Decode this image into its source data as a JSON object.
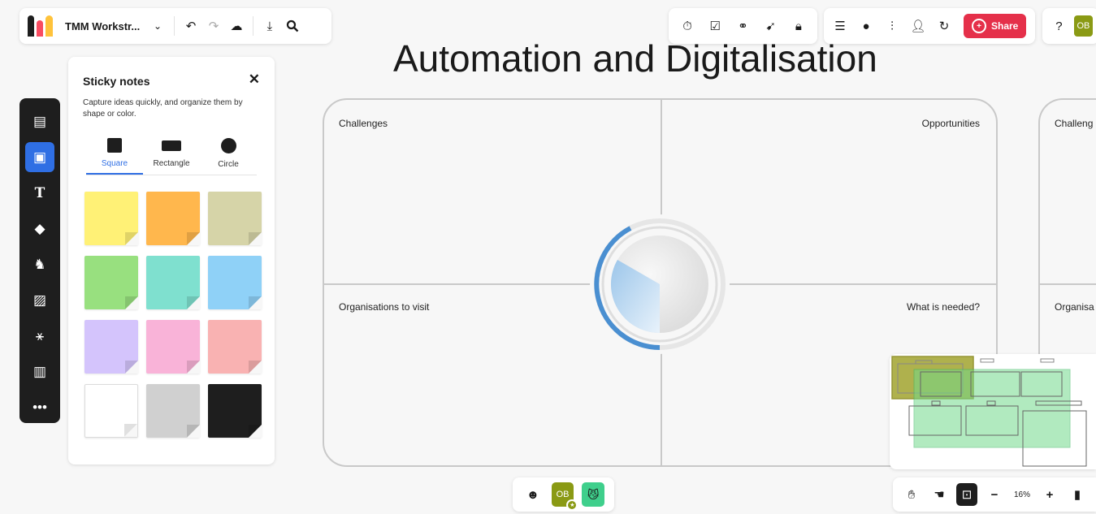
{
  "topbar": {
    "board_name": "TMM Workstr...",
    "colors": {
      "logo": [
        "#f94c61",
        "#ffc33b",
        "#7b5cf5",
        "#1e1e1e"
      ]
    }
  },
  "collab": {
    "share_label": "Share",
    "avatar": "OB"
  },
  "sticky_panel": {
    "title": "Sticky notes",
    "description": "Capture ideas quickly, and organize them by shape or color.",
    "shapes": [
      {
        "label": "Square",
        "icon": "square-shape-icon",
        "active": true
      },
      {
        "label": "Rectangle",
        "icon": "rectangle-shape-icon",
        "active": false
      },
      {
        "label": "Circle",
        "icon": "circle-shape-icon",
        "active": false
      }
    ],
    "colors": [
      "#fff176",
      "#ffb74d",
      "#d6d4a8",
      "#98e07f",
      "#7fe0cf",
      "#8fd1f7",
      "#d4c4fc",
      "#f9b3d8",
      "#f9b2b2",
      "#ffffff",
      "#d0d0d0",
      "#1e1e1e"
    ]
  },
  "board": {
    "title": "Automation and Digitalisation",
    "quadrants": {
      "top_left": "Challenges",
      "top_right": "Opportunities",
      "bottom_left": "Organisations to visit",
      "bottom_right": "What is needed?"
    },
    "second_frame": {
      "top": "Challeng",
      "bottom": "Organisa"
    }
  },
  "bottom_center": {
    "avatar": "OB"
  },
  "bottom_right": {
    "zoom": "16%"
  }
}
